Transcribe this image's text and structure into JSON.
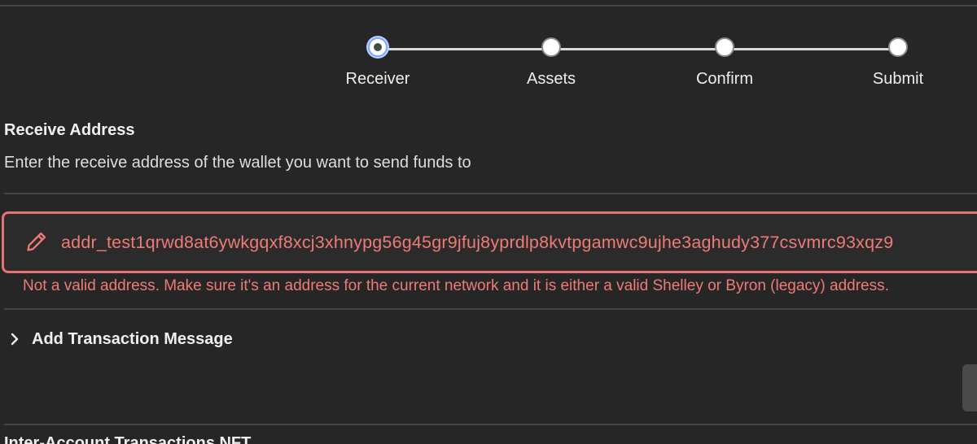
{
  "stepper": {
    "steps": [
      {
        "label": "Receiver",
        "state": "active"
      },
      {
        "label": "Assets",
        "state": "pending"
      },
      {
        "label": "Confirm",
        "state": "pending"
      },
      {
        "label": "Submit",
        "state": "pending"
      }
    ]
  },
  "receive_section": {
    "title": "Receive Address",
    "description": "Enter the receive address of the wallet you want to send funds to",
    "address_value": "addr_test1qrwd8at6ywkgqxf8xcj3xhnypg56g45gr9jfuj8yprdlp8kvtpgamwc9ujhe3aghudy377csvmrc93xqz9",
    "error_message": "Not a valid address. Make sure it's an address for the current network and it is either a valid Shelley or Byron (legacy) address."
  },
  "message_expander": {
    "label": "Add Transaction Message"
  },
  "next_section": {
    "title": "Inter-Account Transactions NFT"
  },
  "colors": {
    "background": "#262626",
    "error": "#ee7b76",
    "text": "#e6e6e6",
    "active_ring": "#7fa7ff"
  },
  "icons": {
    "edit": "pencil-icon",
    "expand": "chevron-right-icon"
  }
}
